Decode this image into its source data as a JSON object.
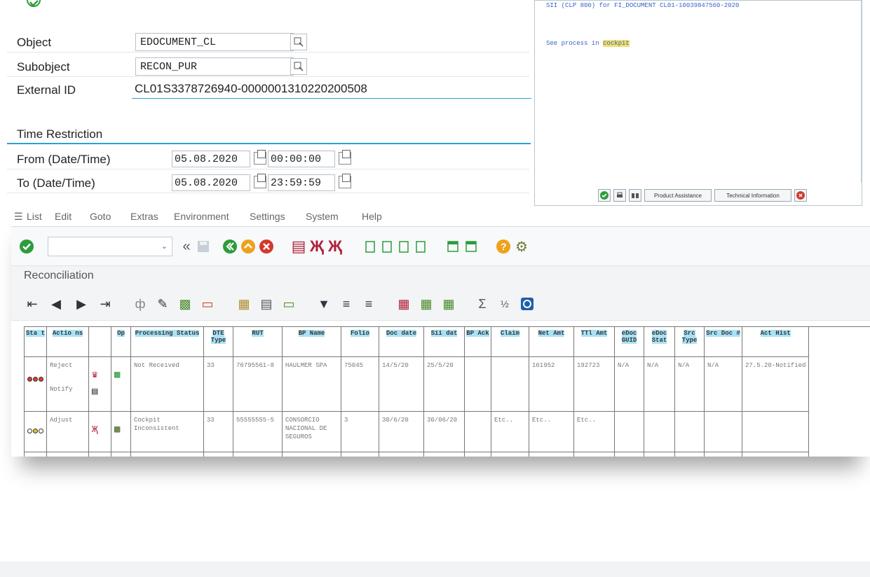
{
  "selection": {
    "object_label": "Object",
    "object_value": "EDOCUMENT_CL",
    "subobject_label": "Subobject",
    "subobject_value": "RECON_PUR",
    "external_id_label": "External ID",
    "external_id_value": "CL01S3378726940-0000001310220200508",
    "time_section": "Time Restriction",
    "from_label": "From (Date/Time)",
    "from_date": "05.08.2020",
    "from_time": "00:00:00",
    "to_label": "To (Date/Time)",
    "to_date": "05.08.2020",
    "to_time": "23:59:59"
  },
  "dialog": {
    "message_line": "SII (CLP 800) for FI_DOCUMENT CL01-10039847560-2020",
    "see_process": "See process in",
    "cockpit_link": "cockpit",
    "product_assistance": "Product Assistance",
    "technical_information": "Technical Information"
  },
  "menu": {
    "list": "List",
    "edit": "Edit",
    "goto": "Goto",
    "extras": "Extras",
    "environment": "Environment",
    "settings": "Settings",
    "system": "System",
    "help": "Help"
  },
  "screen_title": "Reconciliation",
  "table": {
    "headers": [
      "Sta t",
      "Actio ns",
      "",
      "Op",
      "Processing Status",
      "DTE Type",
      "RUT",
      "BP Name",
      "Folio",
      "Doc date",
      "Sii dat",
      "BP Ack",
      "Claim",
      "Net Amt",
      "TTl Amt",
      "eDoc GUID",
      "eDoc Stat",
      "Src Type",
      "Src Doc #",
      "Act Hist"
    ],
    "row1": {
      "action1": "Reject",
      "action2": "Notify",
      "processing_status": "Not Received",
      "dte_type": "33",
      "rut": "76795561-8",
      "bp_name": "HAULMER SPA",
      "folio": "75045",
      "doc_date": "14/5/20",
      "sii_date": "25/5/20",
      "bp_ack": "",
      "claim": "",
      "net_amt": "161952",
      "ttl_amt": "192723",
      "edoc_guid": "N/A",
      "edoc_stat": "N/A",
      "src_type": "N/A",
      "src_doc": "N/A",
      "act_hist": "27.5.20-Notified"
    },
    "row2": {
      "action1": "Adjust",
      "processing_status": "Cockpit Inconsistent",
      "dte_type": "33",
      "rut": "55555555-5",
      "bp_name": "CONSORCIO NACIONAL DE SEGUROS",
      "folio": "3",
      "doc_date": "30/6/20",
      "sii_date": "30/06/20",
      "bp_ack": "",
      "claim": "Etc..",
      "net_amt": "Etc..",
      "ttl_amt": "Etc.."
    }
  },
  "colors": {
    "accent_blue": "#2d9fd8",
    "header_highlight": "#a9e2f5",
    "ok_green": "#2e9b3c",
    "cancel_red": "#d23a2e"
  }
}
